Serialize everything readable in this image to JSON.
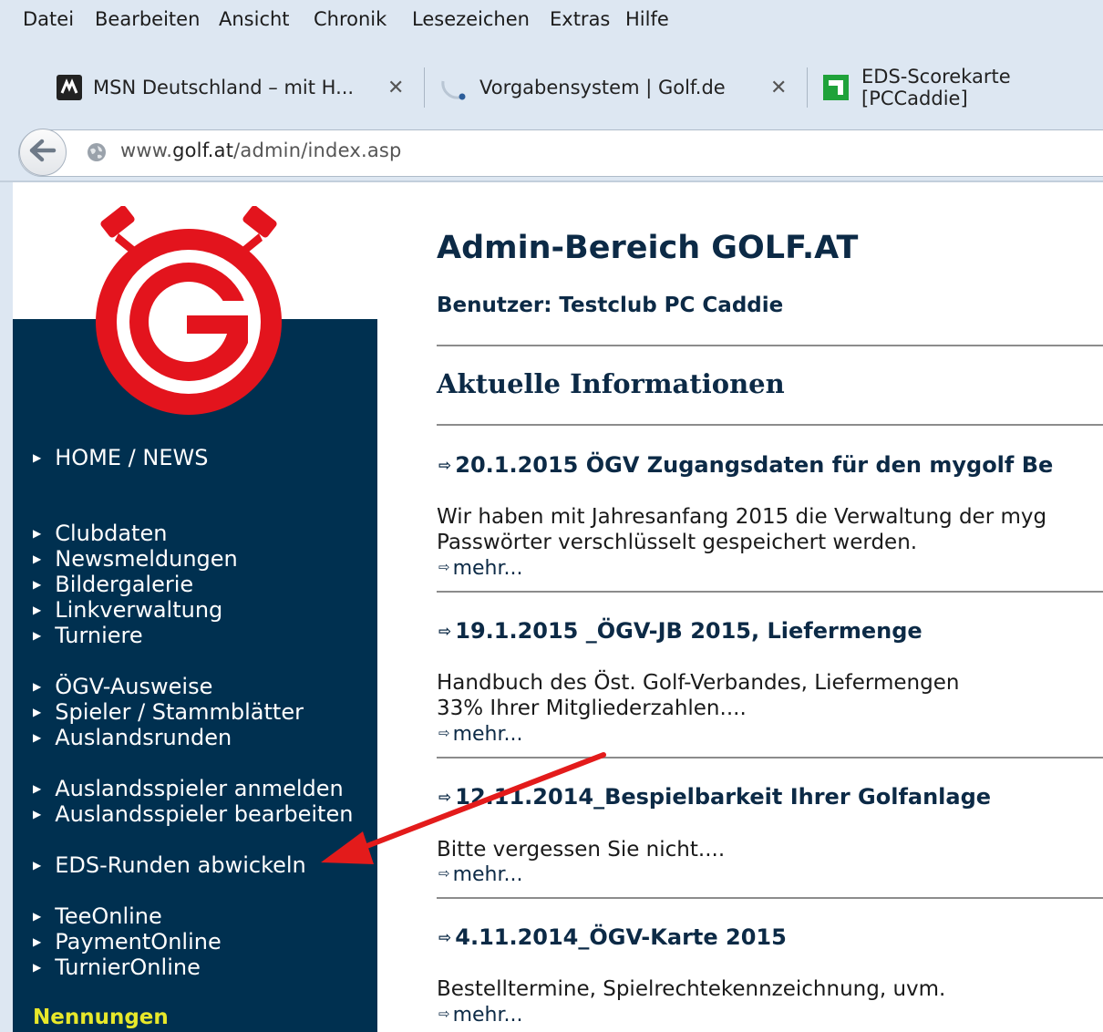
{
  "menubar": {
    "items": [
      "Datei",
      "Bearbeiten",
      "Ansicht",
      "Chronik",
      "Lesezeichen",
      "Extras",
      "Hilfe"
    ]
  },
  "tabs": [
    {
      "title": "MSN Deutschland – mit H...",
      "icon": "msn-icon"
    },
    {
      "title": "Vorgabensystem | Golf.de",
      "icon": "loading-icon"
    },
    {
      "title": "EDS-Scorekarte [PCCaddie]",
      "icon": "pccaddie-icon"
    }
  ],
  "address": {
    "prefix": "www.",
    "domain": "golf.at",
    "path": "/admin/index.asp"
  },
  "sidebar": {
    "home": "HOME / NEWS",
    "group1": [
      "Clubdaten",
      "Newsmeldungen",
      "Bildergalerie",
      "Linkverwaltung",
      "Turniere"
    ],
    "group2": [
      "ÖGV-Ausweise",
      "Spieler / Stammblätter",
      "Auslandsrunden"
    ],
    "group3": [
      "Auslandsspieler anmelden",
      "Auslandsspieler bearbeiten"
    ],
    "group4": [
      "EDS-Runden abwickeln"
    ],
    "group5": [
      "TeeOnline",
      "PaymentOnline",
      "TurnierOnline"
    ],
    "nennungen": "Nennungen"
  },
  "main": {
    "title": "Admin-Bereich GOLF.AT",
    "user": "Benutzer: Testclub PC Caddie",
    "section": "Aktuelle Informationen",
    "news": [
      {
        "title": "20.1.2015 ÖGV Zugangsdaten für den mygolf Be",
        "body": [
          "Wir haben mit Jahresanfang 2015 die Verwaltung der myg",
          "Passwörter verschlüsselt gespeichert werden."
        ],
        "more": "mehr..."
      },
      {
        "title": "19.1.2015 _ÖGV-JB 2015, Liefermenge",
        "body": [
          "Handbuch des Öst. Golf-Verbandes, Liefermengen",
          "33% Ihrer Mitgliederzahlen...."
        ],
        "more": "mehr..."
      },
      {
        "title": "12.11.2014_Bespielbarkeit Ihrer Golfanlage",
        "body": [
          "Bitte vergessen Sie nicht...."
        ],
        "more": "mehr..."
      },
      {
        "title": "4.11.2014_ÖGV-Karte 2015",
        "body": [
          "Bestelltermine, Spielrechtekennzeichnung, uvm."
        ],
        "more": "mehr..."
      }
    ]
  },
  "colors": {
    "sidebar": "#003050",
    "heading": "#0c2a46",
    "logo_red": "#e3141d",
    "nennungen": "#e8e82a",
    "arrow": "#e31b1b"
  }
}
